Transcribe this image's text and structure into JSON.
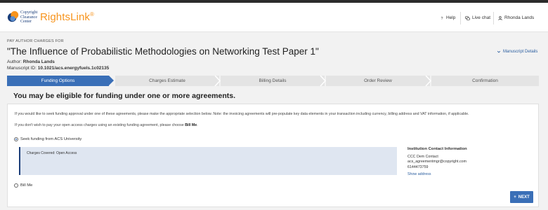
{
  "header": {
    "logo_text_lines": [
      "Copyright",
      "Clearance",
      "Center"
    ],
    "brand": "RightsLink",
    "brand_mark": "®",
    "nav": {
      "help": "Help",
      "live_chat": "Live chat",
      "user": "Rhonda Lands"
    }
  },
  "page": {
    "breadcrumb": "PAY AUTHOR CHARGES FOR",
    "title": "\"The Influence of Probabilistic Methodologies on Networking Test Paper 1\"",
    "author_label": "Author:",
    "author_value": "Rhonda Lands",
    "manuscript_label": "Manuscript ID:",
    "manuscript_value": "10.1021/acs.energyfuels.1c02135",
    "manuscript_details": "Manuscript Details"
  },
  "steps": [
    {
      "label": "Funding Options",
      "active": true
    },
    {
      "label": "Charges Estimate",
      "active": false
    },
    {
      "label": "Billing Details",
      "active": false
    },
    {
      "label": "Order Review",
      "active": false
    },
    {
      "label": "Confirmation",
      "active": false
    }
  ],
  "main": {
    "heading": "You may be eligible for funding under one or more agreements.",
    "intro": "If you would like to seek funding approval under one of these agreements, please make the appropriate selection below. Note: the invoicing agreements will pre-populate key data elements in your transaction including currency, billing address and VAT information, if applicable.",
    "bill_me_prefix": "If you don't wish to pay your open access charges using an existing funding agreement, please choose",
    "bill_me_bold": "Bill Me",
    "bill_me_suffix": ".",
    "option_acs": "Seek funding from ACS University",
    "charges_covered": "Charges Covered: Open Access",
    "option_bill_me": "Bill Me",
    "next_label": "NEXT"
  },
  "contact": {
    "heading": "Institution Contact Information",
    "name": "CCC Dem Contact",
    "email": "acs_agreementmgr@copyright.com",
    "phone": "6144473759",
    "show_address": "Show address"
  },
  "colors": {
    "accent": "#3a6fb7",
    "brand_orange": "#f7941d",
    "box_border": "#1d3f7a"
  },
  "icons": {
    "help": "question-icon",
    "chat": "chat-icon",
    "user": "user-icon",
    "chevron": "chevron-down-icon",
    "next": "plus-icon"
  }
}
